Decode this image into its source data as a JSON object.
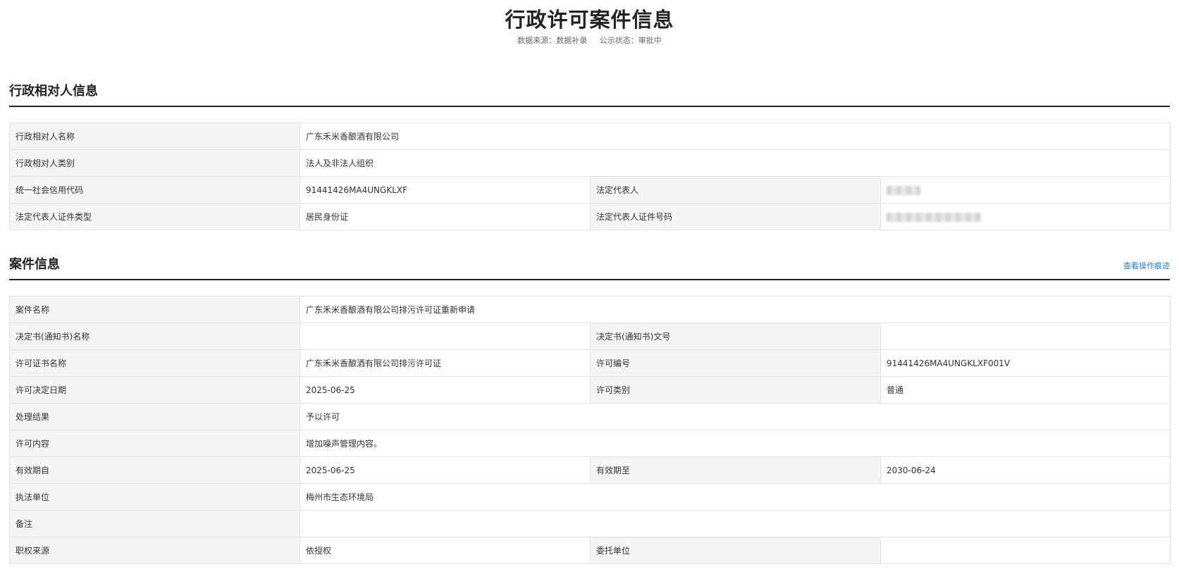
{
  "header": {
    "title": "行政许可案件信息",
    "source_label": "数据来源：数据补录",
    "status_label": "公示状态：审批中"
  },
  "party_section": {
    "title": "行政相对人信息",
    "name_label": "行政相对人名称",
    "name_value": "广东禾米香酿酒有限公司",
    "category_label": "行政相对人类别",
    "category_value": "法人及非法人组织",
    "credit_code_label": "统一社会信用代码",
    "credit_code_value": "91441426MA4UNGKLXF",
    "legal_rep_label": "法定代表人",
    "id_type_label": "法定代表人证件类型",
    "id_type_value": "居民身份证",
    "id_number_label": "法定代表人证件号码"
  },
  "case_section": {
    "title": "案件信息",
    "trace_link": "查看操作痕迹",
    "case_name_label": "案件名称",
    "case_name_value": "广东禾米香酿酒有限公司排污许可证重新申请",
    "decision_name_label": "决定书(通知书)名称",
    "decision_no_label": "决定书(通知书)文号",
    "license_name_label": "许可证书名称",
    "license_name_value": "广东禾米香酿酒有限公司排污许可证",
    "license_no_label": "许可编号",
    "license_no_value": "91441426MA4UNGKLXF001V",
    "decision_date_label": "许可决定日期",
    "decision_date_value": "2025-06-25",
    "license_type_label": "许可类别",
    "license_type_value": "普通",
    "result_label": "处理结果",
    "result_value": "予以许可",
    "content_label": "许可内容",
    "content_value": "增加噪声管理内容。",
    "valid_from_label": "有效期自",
    "valid_from_value": "2025-06-25",
    "valid_to_label": "有效期至",
    "valid_to_value": "2030-06-24",
    "agency_label": "执法单位",
    "agency_value": "梅州市生态环境局",
    "remark_label": "备注",
    "authority_source_label": "职权来源",
    "authority_source_value": "依授权",
    "entrusted_label": "委托单位"
  }
}
